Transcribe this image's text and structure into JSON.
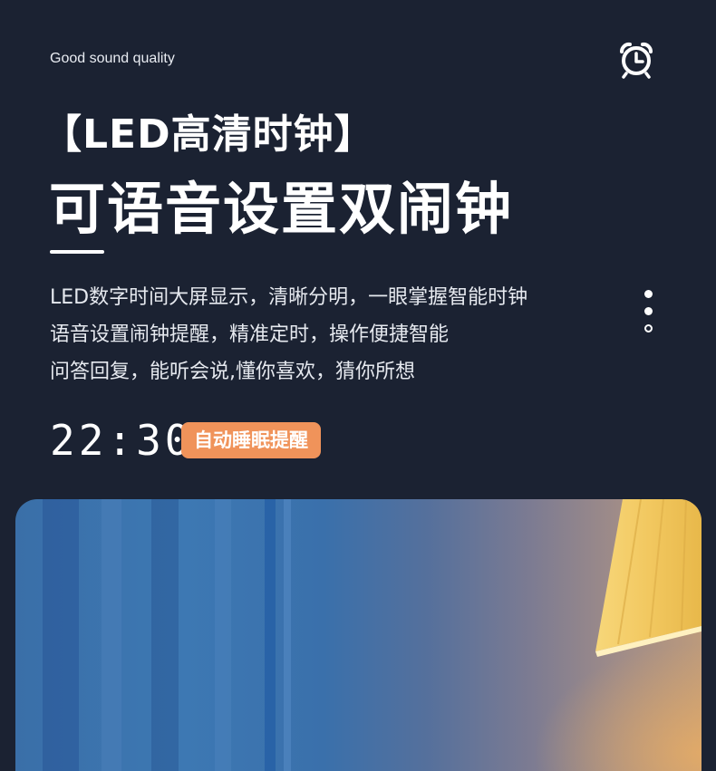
{
  "header": {
    "tagline": "Good sound quality",
    "icon": "alarm-clock-icon"
  },
  "title": {
    "line1": "【LED高清时钟】",
    "line2": "可语音设置双闹钟"
  },
  "description": [
    "LED数字时间大屏显示，清晰分明，一眼掌握智能时钟",
    "语音设置闹钟提醒，精准定时，操作便捷智能",
    "问答回复，能听会说,懂你喜欢，猜你所想"
  ],
  "clock": {
    "time": "22:30",
    "badge": "自动睡眠提醒"
  },
  "colors": {
    "background": "#1b2232",
    "badge": "#f0935a",
    "text": "#ffffff"
  },
  "photo": {
    "subject": "lamp-shade-image"
  }
}
